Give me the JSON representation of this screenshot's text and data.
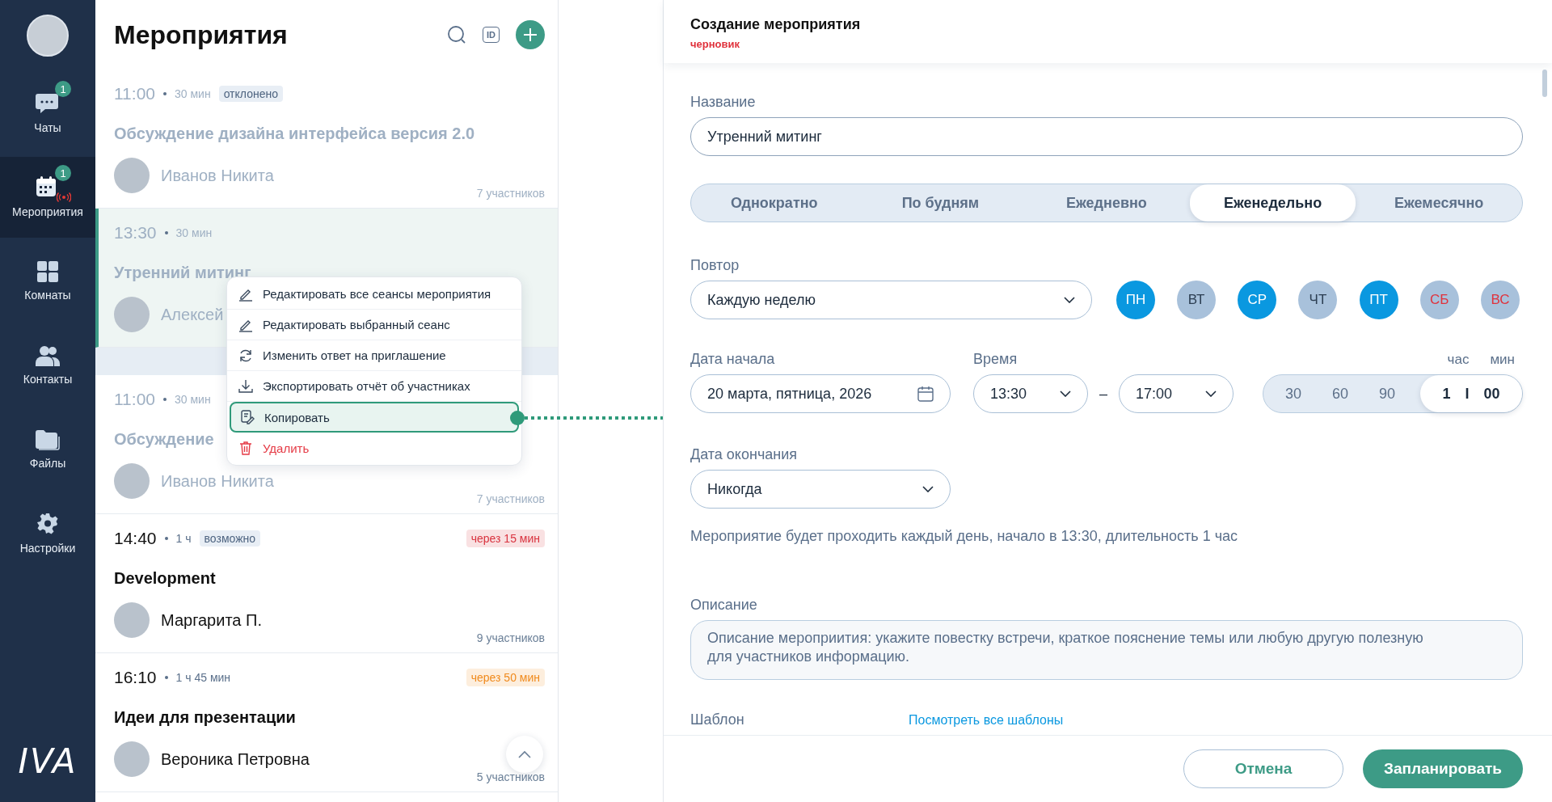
{
  "sidebar": {
    "nav": [
      {
        "label": "Чаты",
        "badge": "1",
        "selected": false,
        "live": false
      },
      {
        "label": "Мероприятия",
        "badge": "1",
        "selected": true,
        "live": true
      },
      {
        "label": "Комнаты",
        "selected": false,
        "live": false
      },
      {
        "label": "Контакты",
        "selected": false,
        "live": false
      },
      {
        "label": "Файлы",
        "selected": false,
        "live": false
      },
      {
        "label": "Настройки",
        "selected": false,
        "live": false
      }
    ],
    "logo": "IVA"
  },
  "events_panel": {
    "title": "Мероприятия",
    "id_button": "ID",
    "events": [
      {
        "time": "11:00",
        "duration": "30 мин",
        "status": "отклонено",
        "title": "Обсуждение дизайна интерфейса версия 2.0",
        "organizer": "Иванов Никита",
        "participants": "7 участников",
        "muted": true,
        "selected": false,
        "group_start": false
      },
      {
        "time": "13:30",
        "duration": "30 мин",
        "title": "Утренний митинг",
        "organizer": "Алексей",
        "muted": true,
        "selected": true,
        "group_start": false
      },
      {
        "time": "11:00",
        "duration": "30 мин",
        "title": "Обсуждение",
        "organizer": "Иванов Никита",
        "participants": "7 участников",
        "muted": true,
        "selected": false,
        "group_start": true
      },
      {
        "time": "14:40",
        "duration": "1 ч",
        "status": "возможно",
        "countdown": {
          "text": "через 15 мин",
          "color": "#d9333f"
        },
        "title": "Development",
        "organizer": "Маргарита П.",
        "participants": "9 участников",
        "muted": false,
        "selected": false,
        "group_start": false
      },
      {
        "time": "16:10",
        "duration": "1 ч 45 мин",
        "countdown": {
          "text": "через 50 мин",
          "color": "#f08a1c"
        },
        "title": "Идеи для презентации",
        "organizer": "Вероника Петровна",
        "participants": "5 участников",
        "muted": false,
        "selected": false,
        "group_start": false
      }
    ],
    "context_menu": [
      {
        "label": "Редактировать все сеансы мероприятия",
        "selected": false,
        "danger": false
      },
      {
        "label": "Редактировать выбранный сеанс",
        "selected": false,
        "danger": false
      },
      {
        "label": "Изменить ответ на приглашение",
        "selected": false,
        "danger": false
      },
      {
        "label": "Экспортировать отчёт об участниках",
        "selected": false,
        "danger": false
      },
      {
        "label": "Копировать",
        "selected": true,
        "danger": false
      },
      {
        "label": "Удалить",
        "selected": false,
        "danger": true
      }
    ]
  },
  "editor": {
    "title": "Создание мероприятия",
    "status": "черновик",
    "name_field": {
      "label": "Название",
      "value": "Утренний митинг"
    },
    "repeat_modes": [
      {
        "label": "Однократно",
        "selected": false
      },
      {
        "label": "По будням",
        "selected": false
      },
      {
        "label": "Ежедневно",
        "selected": false
      },
      {
        "label": "Еженедельно",
        "selected": true
      },
      {
        "label": "Ежемесячно",
        "selected": false
      }
    ],
    "repeat": {
      "label": "Повтор",
      "value": "Каждую неделю"
    },
    "days": [
      {
        "label": "ПН",
        "selected": true,
        "kind": "weekday"
      },
      {
        "label": "ВТ",
        "selected": false,
        "kind": "weekday"
      },
      {
        "label": "СР",
        "selected": true,
        "kind": "weekday"
      },
      {
        "label": "ЧТ",
        "selected": false,
        "kind": "weekday"
      },
      {
        "label": "ПТ",
        "selected": true,
        "kind": "weekday"
      },
      {
        "label": "СБ",
        "selected": false,
        "kind": "weekend"
      },
      {
        "label": "ВС",
        "selected": false,
        "kind": "weekend"
      }
    ],
    "start_date": {
      "label": "Дата начала",
      "value": "20 марта, пятница, 2026"
    },
    "time": {
      "label": "Время",
      "start": "13:30",
      "separator": "–",
      "end": "17:00"
    },
    "duration": {
      "hour_label": "час",
      "minute_label": "мин",
      "presets": [
        {
          "label": "30",
          "selected": false
        },
        {
          "label": "60",
          "selected": false
        },
        {
          "label": "90",
          "selected": false
        }
      ],
      "custom": {
        "hours": "1",
        "separator": "I",
        "minutes": "00",
        "selected": true
      }
    },
    "end_date": {
      "label": "Дата окончания",
      "value": "Никогда"
    },
    "summary": "Мероприятие будет проходить каждый день, начало в 13:30, длительность 1 час",
    "description": {
      "label": "Описание",
      "placeholder": "Описание мероприития: укажите повестку встречи, краткое пояснение темы или любую другую полезную для участников информацию."
    },
    "template": {
      "label": "Шаблон",
      "link": "Посмотреть все шаблоны"
    },
    "buttons": {
      "cancel": "Отмена",
      "submit": "Запланировать"
    }
  }
}
